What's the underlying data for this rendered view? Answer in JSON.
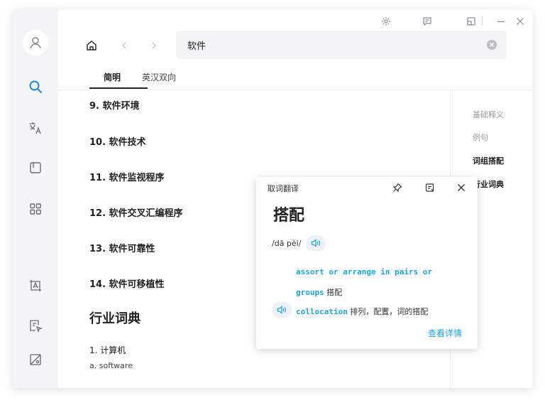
{
  "search": {
    "query": "软件"
  },
  "tabs": [
    {
      "label": "简明"
    },
    {
      "label": "英汉双向"
    }
  ],
  "content": {
    "items": [
      {
        "label": "9. 软件环境"
      },
      {
        "label": "10. 软件技术"
      },
      {
        "label": "11. 软件监视程序"
      },
      {
        "label": "12. 软件交叉汇编程序"
      },
      {
        "label": "13. 软件可靠性"
      },
      {
        "label": "14. 软件可移植性"
      }
    ],
    "industry_heading": "行业词典",
    "industry_item": "1. 计算机",
    "industry_sub": "a. software"
  },
  "rightnav": [
    {
      "label": "基础释义"
    },
    {
      "label": "例句"
    },
    {
      "label": "词组搭配"
    },
    {
      "label": "行业词典"
    }
  ],
  "popup": {
    "title": "取词翻译",
    "word": "搭配",
    "phonetic": "/dā pèi/",
    "definitions": [
      {
        "en_line1": "assort or arrange in pairs or",
        "en_line2": "groups",
        "zh": "搭配"
      },
      {
        "en": "collocation",
        "zh": "排列，配置，词的搭配"
      }
    ],
    "detail_link": "查看详情"
  },
  "colors": {
    "accent": "#1aa6e6",
    "active_nav": "#1e88e5"
  },
  "icons": {
    "sidebar": [
      "user-icon",
      "search-icon",
      "translate-icon",
      "book-icon",
      "apps-icon",
      "screenshot-translate-icon",
      "doc-translate-icon",
      "settings-off-icon"
    ],
    "titlebar": [
      "gear-icon",
      "feedback-icon",
      "mini-window-icon",
      "minimize-icon",
      "close-icon"
    ],
    "nav": [
      "home-icon",
      "back-icon",
      "forward-icon"
    ],
    "popup": [
      "pin-icon",
      "open-external-icon",
      "close-icon",
      "speaker-icon"
    ]
  }
}
